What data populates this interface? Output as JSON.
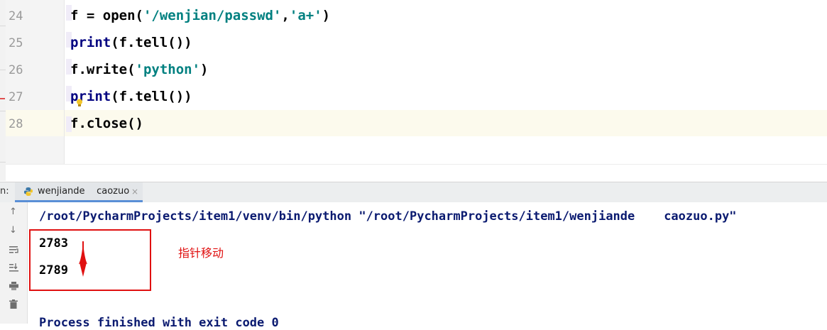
{
  "editor": {
    "line_numbers": [
      "24",
      "25",
      "26",
      "27",
      "28"
    ],
    "lines": [
      {
        "parts": [
          {
            "t": "f = open(",
            "c": "plain"
          },
          {
            "t": "'/wenjian/passwd'",
            "c": "str"
          },
          {
            "t": ",",
            "c": "plain"
          },
          {
            "t": "'a+'",
            "c": "str"
          },
          {
            "t": ")",
            "c": "plain"
          }
        ]
      },
      {
        "parts": [
          {
            "t": "print",
            "c": "builtin"
          },
          {
            "t": "(f.tell())",
            "c": "plain"
          }
        ]
      },
      {
        "parts": [
          {
            "t": "f.write(",
            "c": "plain"
          },
          {
            "t": "'python'",
            "c": "str"
          },
          {
            "t": ")",
            "c": "plain"
          }
        ]
      },
      {
        "parts": [
          {
            "t": "print",
            "c": "builtin"
          },
          {
            "t": "(f.tell())",
            "c": "plain"
          }
        ]
      },
      {
        "parts": [
          {
            "t": "f.close()",
            "c": "plain"
          }
        ]
      }
    ],
    "current_line_index": 4
  },
  "run_panel": {
    "label": "n:",
    "tab_label": "wenjiande    caozuo",
    "tab_close": "×",
    "toolbar_icons": [
      "up-arrow-icon",
      "down-arrow-icon",
      "soft-wrap-icon",
      "scroll-to-end-icon",
      "print-icon",
      "trash-icon"
    ]
  },
  "console": {
    "command": "/root/PycharmProjects/item1/venv/bin/python \"/root/PycharmProjects/item1/wenjiande    caozuo.py\"",
    "outputs": [
      "2783",
      "2789"
    ],
    "finish": "Process finished with exit code 0"
  },
  "annotation": {
    "text": "指针移动",
    "color": "#e01010"
  },
  "colors": {
    "builtin": "#000080",
    "string": "#008080",
    "console_cmd": "#0a1a70",
    "tab_underline": "#5a8fd6",
    "current_line": "#fcfaed"
  }
}
